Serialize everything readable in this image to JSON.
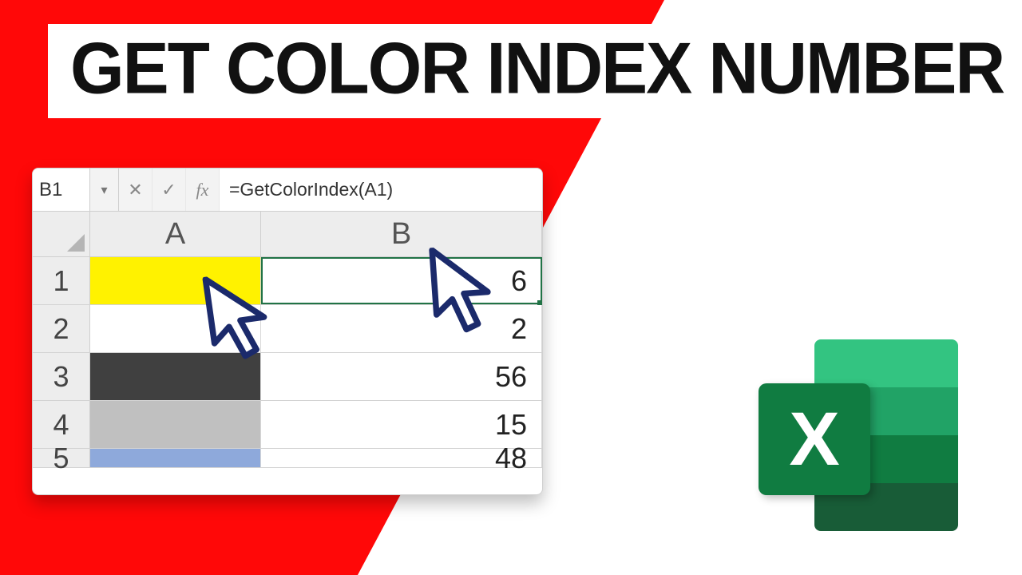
{
  "title": "GET COLOR INDEX NUMBER",
  "formula_bar": {
    "name_box": "B1",
    "cancel_glyph": "✕",
    "enter_glyph": "✓",
    "fx_glyph": "fx",
    "formula": "=GetColorIndex(A1)"
  },
  "columns": {
    "a": "A",
    "b": "B"
  },
  "rows": [
    {
      "num": "1",
      "a_bg": "#fff200",
      "b_val": "6",
      "selected": true
    },
    {
      "num": "2",
      "a_bg": "#ffffff",
      "b_val": "2",
      "selected": false
    },
    {
      "num": "3",
      "a_bg": "#404040",
      "b_val": "56",
      "selected": false
    },
    {
      "num": "4",
      "a_bg": "#c0c0c0",
      "b_val": "15",
      "selected": false
    },
    {
      "num": "5",
      "a_bg": "#8ea9db",
      "b_val": "48",
      "selected": false
    }
  ],
  "excel_icon": {
    "letter": "X"
  }
}
